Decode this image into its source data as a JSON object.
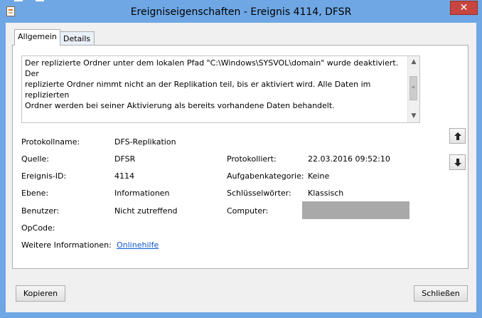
{
  "window": {
    "title": "Ereigniseigenschaften - Ereignis 4114, DFSR",
    "close_glyph": "✕"
  },
  "tabs": [
    {
      "label": "Allgemein",
      "selected": true
    },
    {
      "label": "Details",
      "selected": false
    }
  ],
  "description": "Der replizierte Ordner unter dem lokalen Pfad \"C:\\Windows\\SYSVOL\\domain\" wurde deaktiviert. Der\nreplizierte Ordner nimmt nicht an der Replikation teil, bis er aktiviert wird. Alle Daten im replizierten\nOrdner werden bei seiner Aktivierung als bereits vorhandene Daten behandelt.\n\nWeitere Informationen:\nName des replizierten Ordners: SYSVOL Share",
  "fields": {
    "protokollname_label": "Protokollname:",
    "protokollname_value": "DFS-Replikation",
    "quelle_label": "Quelle:",
    "quelle_value": "DFSR",
    "protokolliert_label": "Protokolliert:",
    "protokolliert_value": "22.03.2016 09:52:10",
    "ereignis_id_label": "Ereignis-ID:",
    "ereignis_id_value": "4114",
    "aufgabenkategorie_label": "Aufgabenkategorie:",
    "aufgabenkategorie_value": "Keine",
    "ebene_label": "Ebene:",
    "ebene_value": "Informationen",
    "schluesselwoerter_label": "Schlüsselwörter:",
    "schluesselwoerter_value": "Klassisch",
    "benutzer_label": "Benutzer:",
    "benutzer_value": "Nicht zutreffend",
    "computer_label": "Computer:",
    "opcode_label": "OpCode:",
    "weitere_label": "Weitere Informationen:",
    "weitere_link": "Onlinehilfe"
  },
  "buttons": {
    "copy": "Kopieren",
    "close": "Schließen"
  },
  "icons": {
    "app": "event-log-icon",
    "nav_up": "arrow-up-icon",
    "nav_down": "arrow-down-icon"
  },
  "colors": {
    "titlebar": "#6fa7e4",
    "close_button": "#c7463f",
    "link": "#0b57d0",
    "redacted": "#a9a9a9"
  }
}
